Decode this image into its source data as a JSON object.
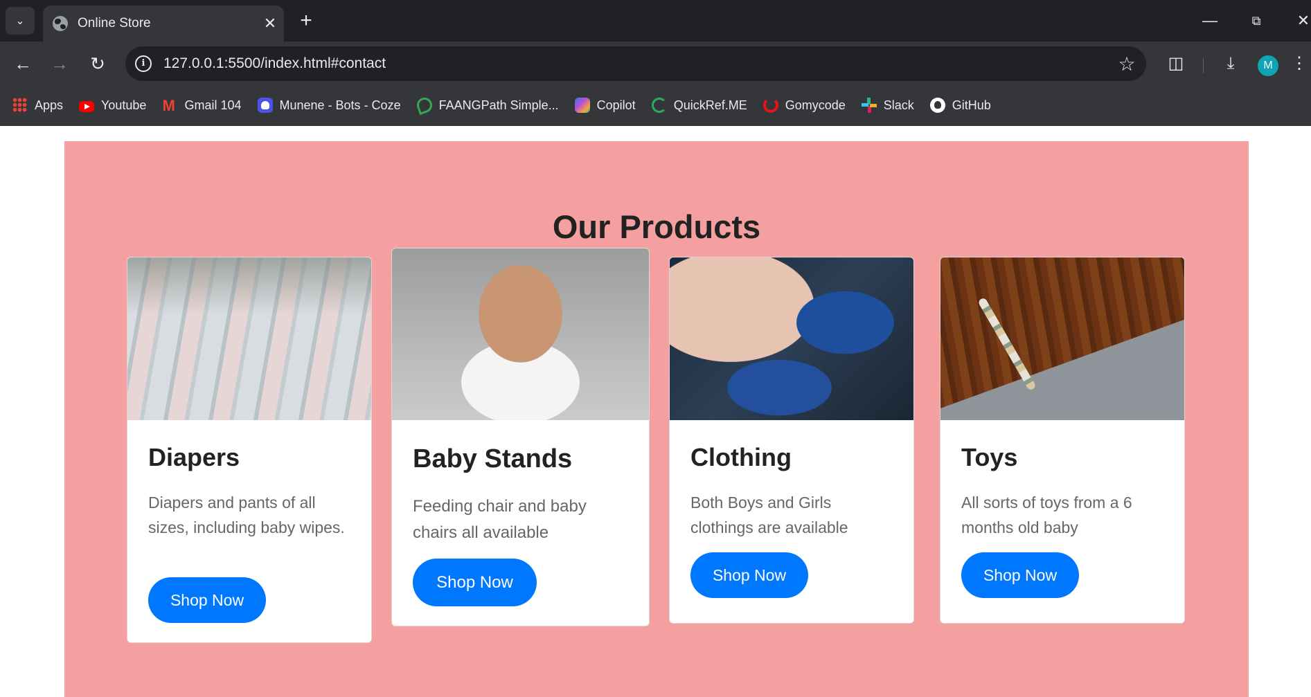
{
  "browser": {
    "tab_title": "Online Store",
    "url": "127.0.0.1:5500/index.html#contact",
    "avatar_letter": "M",
    "bookmarks": [
      {
        "label": "Apps",
        "icon": "apps-grid-icon"
      },
      {
        "label": "Youtube",
        "icon": "youtube-icon"
      },
      {
        "label": "Gmail 104",
        "icon": "gmail-icon"
      },
      {
        "label": "Munene - Bots - Coze",
        "icon": "coze-icon"
      },
      {
        "label": "FAANGPath Simple...",
        "icon": "faangpath-icon"
      },
      {
        "label": "Copilot",
        "icon": "copilot-icon"
      },
      {
        "label": "QuickRef.ME",
        "icon": "quickref-icon"
      },
      {
        "label": "Gomycode",
        "icon": "gomycode-icon"
      },
      {
        "label": "Slack",
        "icon": "slack-icon"
      },
      {
        "label": "GitHub",
        "icon": "github-icon"
      }
    ]
  },
  "section": {
    "title": "Our Products",
    "background_color": "#f4a0a0",
    "button_color": "#0077ff"
  },
  "products": [
    {
      "title": "Diapers",
      "description": "Diapers and pants of all sizes, including baby wipes.",
      "button": "Shop Now"
    },
    {
      "title": "Baby Stands",
      "description": "Feeding chair and baby chairs all available",
      "button": "Shop Now"
    },
    {
      "title": "Clothing",
      "description": "Both Boys and Girls clothings are available",
      "button": "Shop Now"
    },
    {
      "title": "Toys",
      "description": "All sorts of toys from a 6 months old baby",
      "button": "Shop Now"
    }
  ]
}
